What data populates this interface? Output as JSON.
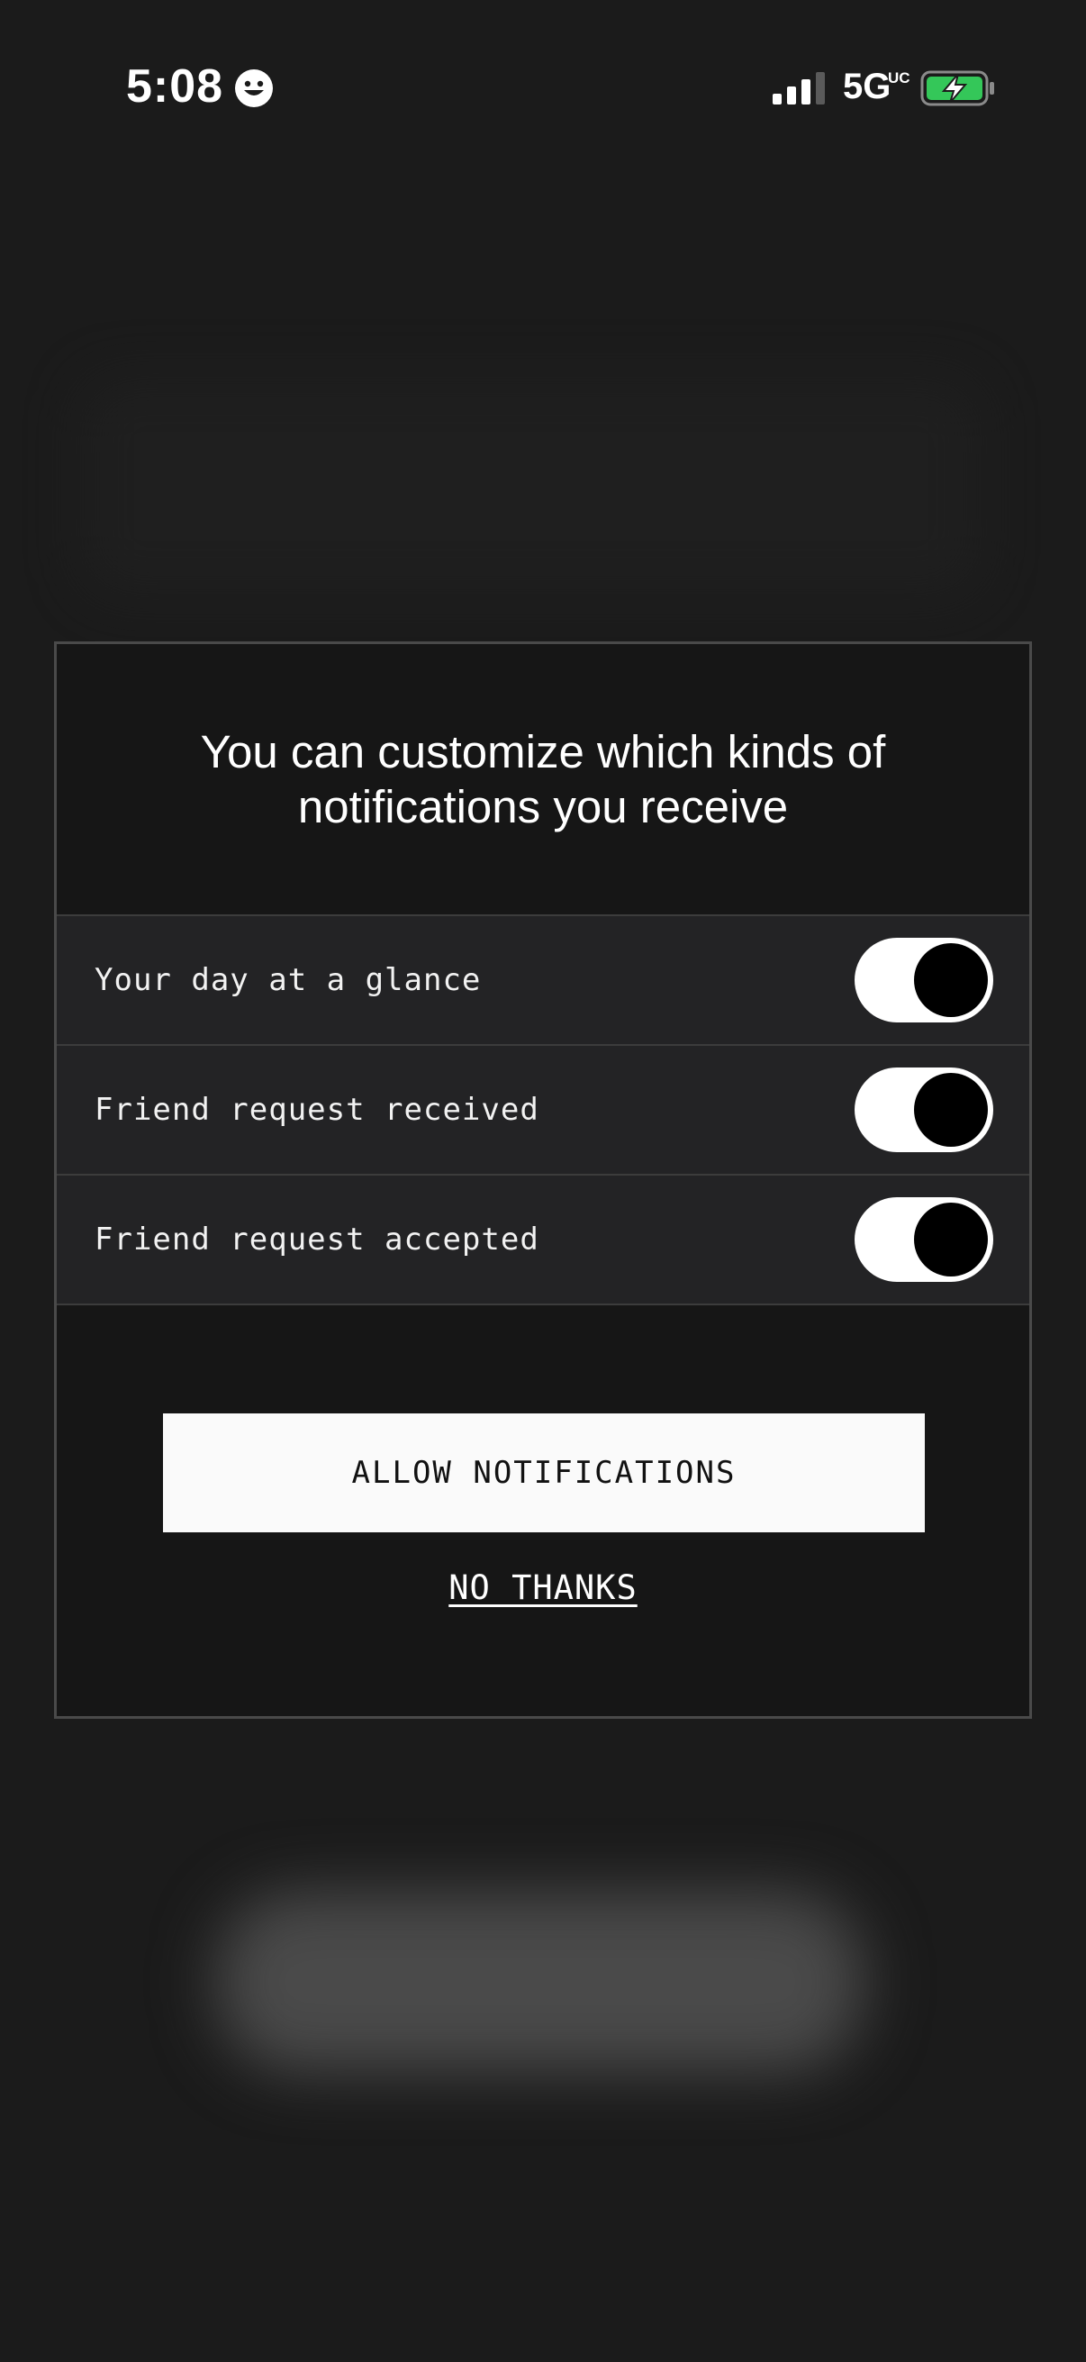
{
  "status_bar": {
    "time": "5:08",
    "status_emoji_icon": "smiley-face-icon",
    "signal_icon": "cellular-signal-icon",
    "network": "5G",
    "network_superscript": "UC",
    "battery_icon": "battery-charging-icon",
    "battery_color": "#34c759"
  },
  "dialog": {
    "title": "You can customize which kinds of notifications you receive",
    "preferences": [
      {
        "label": "Your day at a glance",
        "enabled": true
      },
      {
        "label": "Friend request received",
        "enabled": true
      },
      {
        "label": "Friend request accepted",
        "enabled": true
      }
    ],
    "allow_button_label": "ALLOW NOTIFICATIONS",
    "decline_link_label": "NO THANKS"
  },
  "colors": {
    "background": "#1b1b1b",
    "dialog_background": "#161616",
    "row_background": "#232325",
    "button_background": "#fafafa"
  }
}
